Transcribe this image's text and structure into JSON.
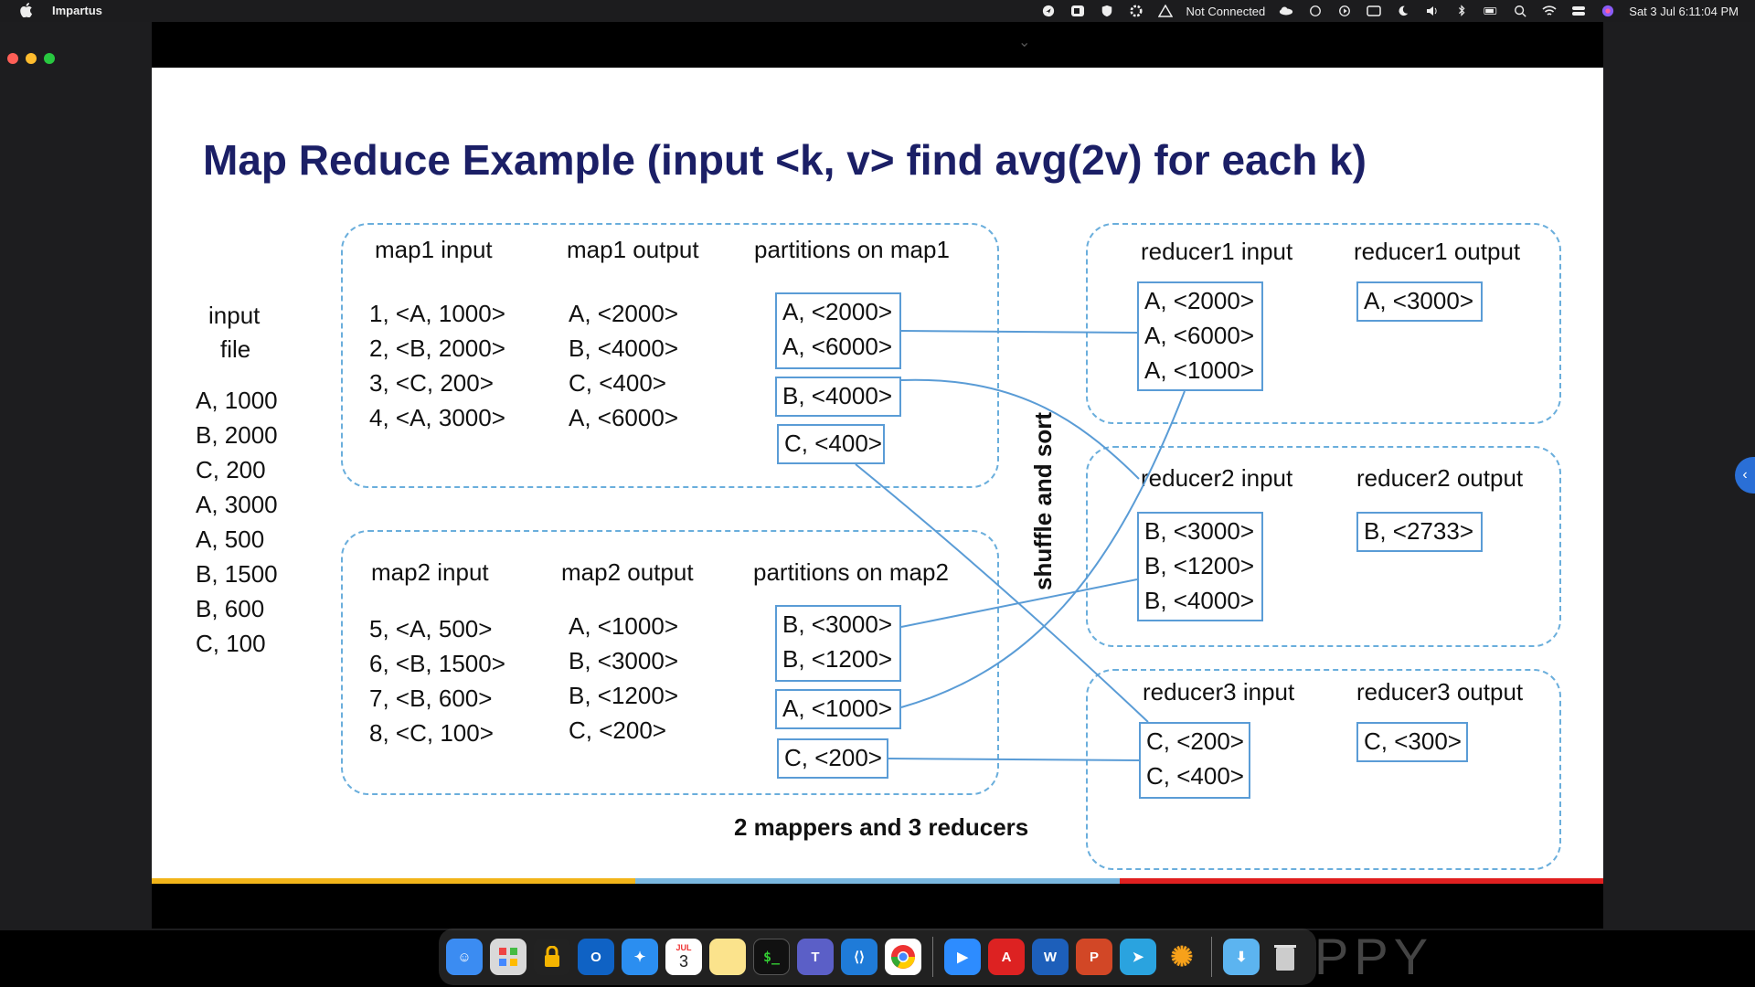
{
  "menubar": {
    "app_name": "Impartus",
    "network_status": "Not Connected",
    "datetime": "Sat 3 Jul  6:11:04 PM"
  },
  "slide": {
    "title": "Map Reduce Example (input  <k, v> find avg(2v) for each k)",
    "input_file": {
      "label_line1": "input",
      "label_line2": "file",
      "items": [
        "A, 1000",
        "B, 2000",
        "C, 200",
        "A, 3000",
        "A, 500",
        "B, 1500",
        "B, 600",
        "C, 100"
      ]
    },
    "map1": {
      "input_header": "map1 input",
      "output_header": "map1 output",
      "partitions_header": "partitions on map1",
      "inputs": [
        "1, <A, 1000>",
        "2, <B, 2000>",
        "3, <C, 200>",
        "4, <A, 3000>"
      ],
      "outputs": [
        "A, <2000>",
        "B, <4000>",
        "C, <400>",
        "A, <6000>"
      ],
      "partitions": [
        [
          "A, <2000>",
          "A, <6000>"
        ],
        [
          "B, <4000>"
        ],
        [
          "C, <400>"
        ]
      ]
    },
    "map2": {
      "input_header": "map2 input",
      "output_header": "map2 output",
      "partitions_header": "partitions on map2",
      "inputs": [
        "5, <A, 500>",
        "6, <B, 1500>",
        "7, <B, 600>",
        "8, <C, 100>"
      ],
      "outputs": [
        "A, <1000>",
        "B, <3000>",
        "B, <1200>",
        "C, <200>"
      ],
      "partitions": [
        [
          "B, <3000>",
          "B, <1200>"
        ],
        [
          "A, <1000>"
        ],
        [
          "C, <200>"
        ]
      ]
    },
    "shuffle_label": "shuffle and sort",
    "reducer1": {
      "input_header": "reducer1 input",
      "output_header": "reducer1 output",
      "inputs": [
        "A, <2000>",
        "A, <6000>",
        "A, <1000>"
      ],
      "output": "A, <3000>"
    },
    "reducer2": {
      "input_header": "reducer2 input",
      "output_header": "reducer2 output",
      "inputs": [
        "B, <3000>",
        "B, <1200>",
        "B, <4000>"
      ],
      "output": "B, <2733>"
    },
    "reducer3": {
      "input_header": "reducer3 input",
      "output_header": "reducer3 output",
      "inputs": [
        "C, <200>",
        "C, <400>"
      ],
      "output": "C, <300>"
    },
    "footer_note": "2 mappers and 3 reducers"
  },
  "dock": {
    "calendar_month": "JUL",
    "calendar_day": "3",
    "apps": [
      "finder",
      "launchpad",
      "keychain",
      "outlook",
      "safari",
      "calendar",
      "notes",
      "terminal",
      "teams",
      "vscode",
      "chrome",
      "zoom",
      "acrobat",
      "word",
      "powerpoint",
      "telegram",
      "burst-app",
      "downloads",
      "trash"
    ]
  },
  "colors": {
    "title": "#1b1f66",
    "box_border": "#5a9cd6",
    "dashed_border": "#6aaedc",
    "bar_yellow": "#f2b51a",
    "bar_blue": "#7ab8e0",
    "bar_red": "#e02020"
  }
}
